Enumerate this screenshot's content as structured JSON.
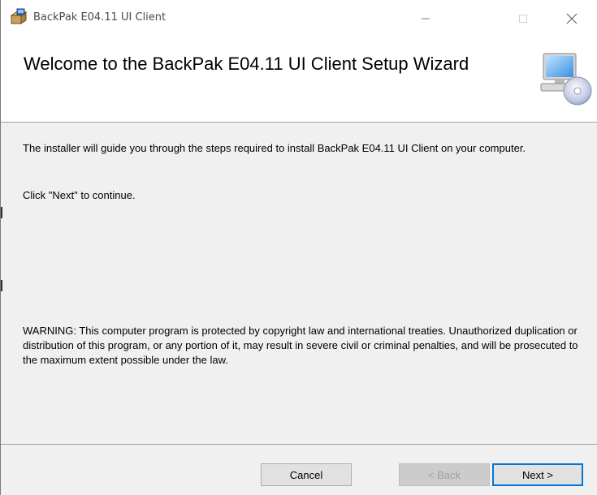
{
  "window": {
    "title": "BackPak E04.11 UI Client"
  },
  "titlebar": {
    "app_icon": "installer-box-icon",
    "minimize_icon": "minimize-icon",
    "maximize_icon": "maximize-icon",
    "close_icon": "close-icon"
  },
  "banner": {
    "title": "Welcome to the BackPak E04.11 UI Client Setup Wizard",
    "icon": "computer-cd-icon"
  },
  "content": {
    "intro": "The installer will guide you through the steps required to install BackPak E04.11 UI Client on your computer.",
    "continue": "Click \"Next\" to continue.",
    "warning": "WARNING: This computer program is protected by copyright law and international treaties. Unauthorized duplication or distribution of this program, or any portion of it, may result in severe civil or criminal penalties, and will be prosecuted to the maximum extent possible under the law."
  },
  "buttons": {
    "cancel": "Cancel",
    "back": "< Back",
    "next": "Next >"
  },
  "colors": {
    "accent": "#0078d7",
    "window_bg": "#f0f0f0",
    "disabled_text": "#a0a0a0"
  }
}
